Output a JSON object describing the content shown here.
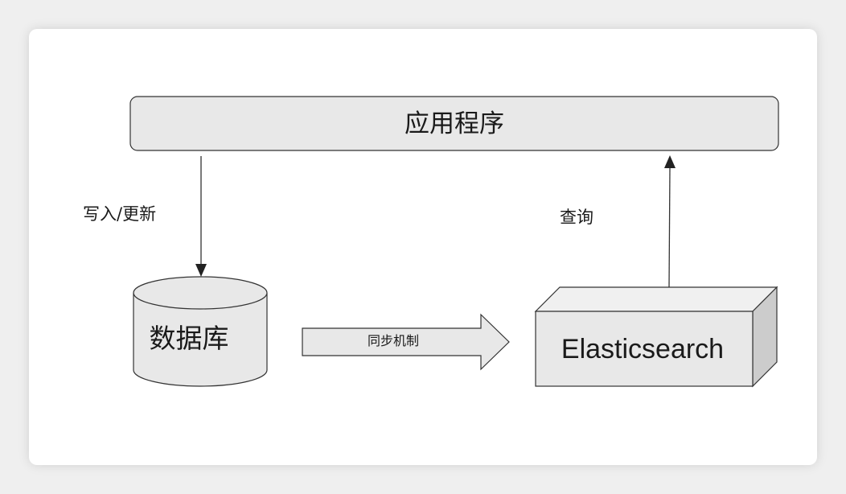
{
  "app": {
    "label": "应用程序"
  },
  "edges": {
    "write_label": "写入/更新",
    "query_label": "查询",
    "sync_label": "同步机制"
  },
  "database": {
    "label": "数据库"
  },
  "search": {
    "label": "Elasticsearch"
  },
  "colors": {
    "box_fill": "#e8e8e8",
    "box_top": "#f0f0f0",
    "box_side": "#cccccc",
    "stroke": "#333333"
  }
}
